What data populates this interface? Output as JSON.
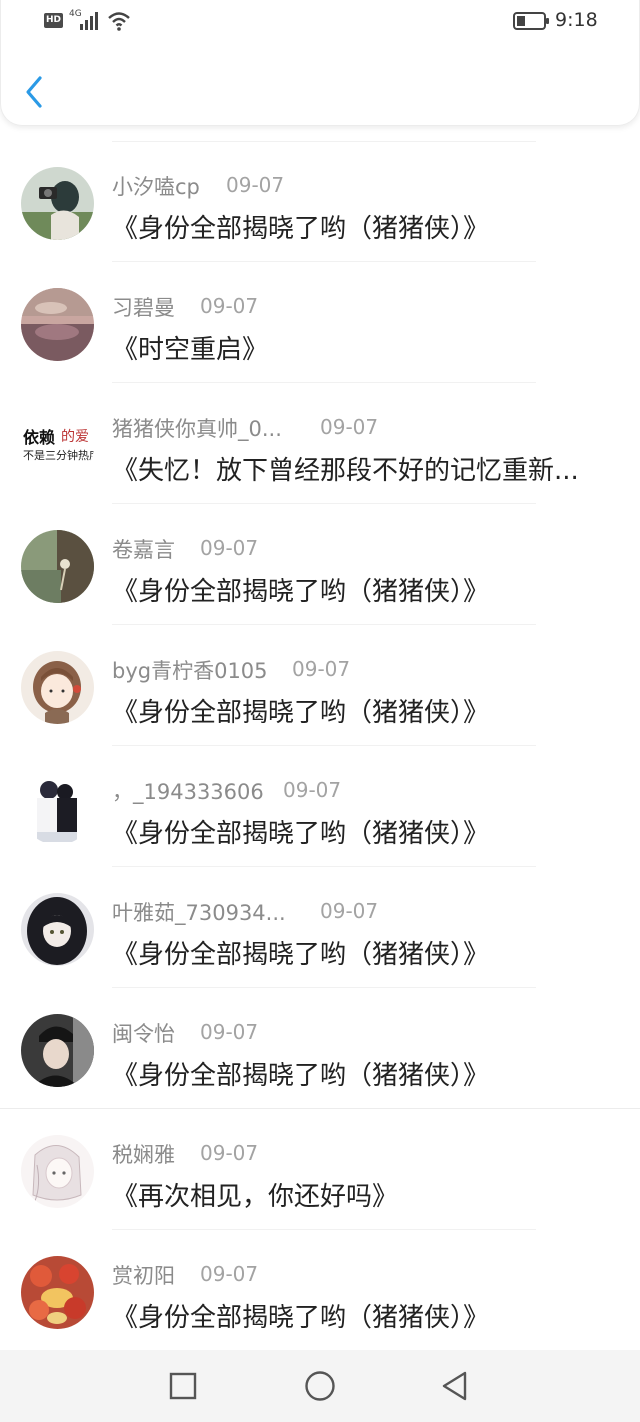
{
  "status_bar": {
    "hd": "HD",
    "network": "4G",
    "time": "9:18"
  },
  "header": {
    "back_icon": "chevron-left-icon",
    "accent_color": "#2b9ae6"
  },
  "items": [
    {
      "username": "小汐嗑cp",
      "date": "09-07",
      "title": "《身份全部揭晓了哟（猪猪侠）》",
      "avatar": "avatar-photo-girl-camera"
    },
    {
      "username": "习碧曼",
      "date": "09-07",
      "title": "《时空重启》",
      "avatar": "avatar-photo-field"
    },
    {
      "username": "猪猪侠你真帅_0...",
      "date": "09-07",
      "title": "《失忆！放下曾经那段不好的记忆重新...",
      "avatar": "avatar-calligraphy",
      "avatar_text": "依赖的爱 不是三分钟热度"
    },
    {
      "username": "卷嘉言",
      "date": "09-07",
      "title": "《身份全部揭晓了哟（猪猪侠）》",
      "avatar": "avatar-photo-dandelion"
    },
    {
      "username": "byg青柠香0105",
      "date": "09-07",
      "title": "《身份全部揭晓了哟（猪猪侠）》",
      "avatar": "avatar-cartoon-girl"
    },
    {
      "username": "，_194333606",
      "date": "09-07",
      "title": "《身份全部揭晓了哟（猪猪侠）》",
      "avatar": "avatar-couple-illustration"
    },
    {
      "username": "叶雅茹_730934...",
      "date": "09-07",
      "title": "《身份全部揭晓了哟（猪猪侠）》",
      "avatar": "avatar-anime-dark-hair"
    },
    {
      "username": "闽令怡",
      "date": "09-07",
      "title": "《身份全部揭晓了哟（猪猪侠）》",
      "avatar": "avatar-photo-man-cap"
    },
    {
      "username": "税娴雅",
      "date": "09-07",
      "title": "《再次相见，你还好吗》",
      "avatar": "avatar-sketch-girl"
    },
    {
      "username": "赏初阳",
      "date": "09-07",
      "title": "《身份全部揭晓了哟（猪猪侠）》",
      "avatar": "avatar-photo-food"
    }
  ],
  "nav": {
    "recent_icon": "square-icon",
    "home_icon": "circle-icon",
    "back_icon": "triangle-back-icon"
  }
}
